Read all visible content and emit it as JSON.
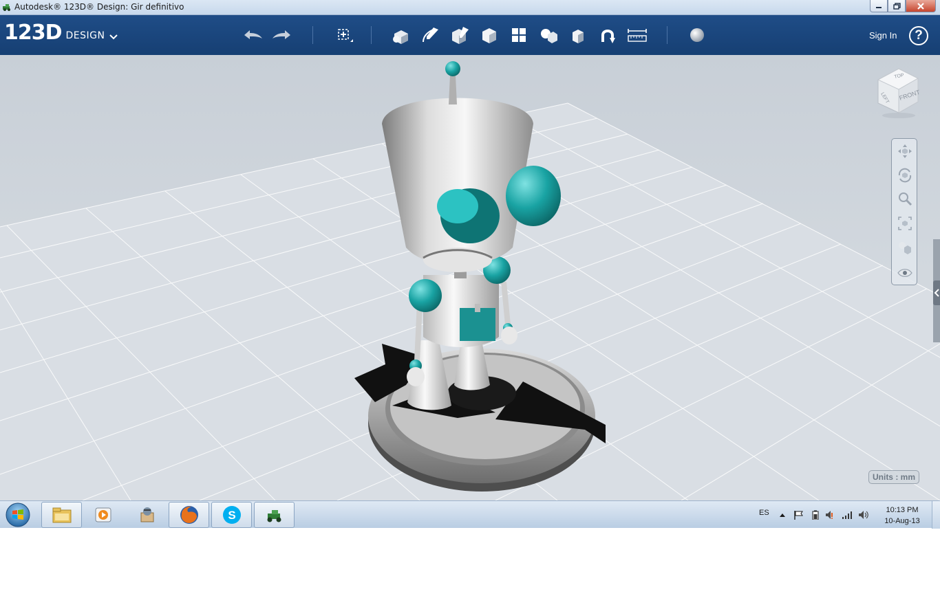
{
  "window": {
    "title": "Autodesk® 123D® Design: Gir definitivo"
  },
  "app": {
    "logo_main": "123D",
    "logo_sub": "DESIGN",
    "sign_in": "Sign In",
    "help": "?",
    "toolbar_icons": [
      "undo-icon",
      "redo-icon",
      "transform-icon",
      "primitives-icon",
      "sketch-icon",
      "construct-icon",
      "modify-icon",
      "pattern-icon",
      "grouping-icon",
      "combine-icon",
      "snap-icon",
      "measure-icon",
      "material-icon"
    ]
  },
  "viewport": {
    "viewcube_faces": {
      "top": "TOP",
      "left": "LEFT",
      "front": "FRONT"
    },
    "units": "Units : mm",
    "nav_tools": [
      "pan-icon",
      "orbit-icon",
      "zoom-icon",
      "fit-icon",
      "view-mode-icon",
      "visibility-icon"
    ]
  },
  "taskbar": {
    "language": "ES",
    "time": "10:13 PM",
    "date": "10-Aug-13",
    "apps": [
      "windows-explorer-icon",
      "media-player-icon",
      "paint-bucket-icon",
      "firefox-icon",
      "skype-icon",
      "123d-design-icon"
    ]
  },
  "colors": {
    "toolbar": "#1d4a82",
    "viewport": "#cdd3da",
    "accent": "#21a8a8"
  }
}
